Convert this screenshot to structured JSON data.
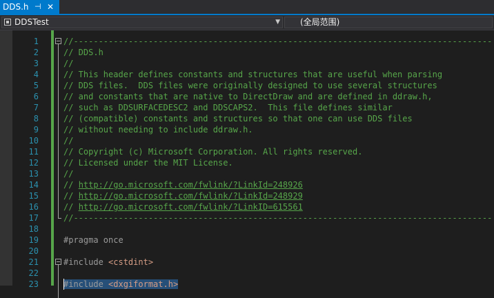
{
  "tab": {
    "filename": "DDS.h",
    "pin_glyph": "⊣",
    "close_glyph": "✕"
  },
  "navigation": {
    "project": "DDSTest",
    "scope": "(全局范围)"
  },
  "editor": {
    "lines": [
      {
        "num": "1",
        "text": "//------------------------------------------------------------------------------------",
        "kind": "comment"
      },
      {
        "num": "2",
        "text": "// DDS.h",
        "kind": "comment"
      },
      {
        "num": "3",
        "text": "//",
        "kind": "comment"
      },
      {
        "num": "4",
        "text": "// This header defines constants and structures that are useful when parsing",
        "kind": "comment"
      },
      {
        "num": "5",
        "text": "// DDS files.  DDS files were originally designed to use several structures",
        "kind": "comment"
      },
      {
        "num": "6",
        "text": "// and constants that are native to DirectDraw and are defined in ddraw.h,",
        "kind": "comment"
      },
      {
        "num": "7",
        "text": "// such as DDSURFACEDESC2 and DDSCAPS2.  This file defines similar",
        "kind": "comment"
      },
      {
        "num": "8",
        "text": "// (compatible) constants and structures so that one can use DDS files",
        "kind": "comment"
      },
      {
        "num": "9",
        "text": "// without needing to include ddraw.h.",
        "kind": "comment"
      },
      {
        "num": "10",
        "text": "//",
        "kind": "comment"
      },
      {
        "num": "11",
        "text": "// Copyright (c) Microsoft Corporation. All rights reserved.",
        "kind": "comment"
      },
      {
        "num": "12",
        "text": "// Licensed under the MIT License.",
        "kind": "comment"
      },
      {
        "num": "13",
        "text": "//",
        "kind": "comment"
      },
      {
        "num": "14",
        "prefix": "// ",
        "link": "http://go.microsoft.com/fwlink/?LinkId=248926",
        "kind": "link"
      },
      {
        "num": "15",
        "prefix": "// ",
        "link": "http://go.microsoft.com/fwlink/?LinkId=248929",
        "kind": "link"
      },
      {
        "num": "16",
        "prefix": "// ",
        "link": "http://go.microsoft.com/fwlink/?LinkID=615561",
        "kind": "link"
      },
      {
        "num": "17",
        "text": "//------------------------------------------------------------------------------------",
        "kind": "comment"
      },
      {
        "num": "18",
        "text": "",
        "kind": "plain"
      },
      {
        "num": "19",
        "text": "#pragma once",
        "kind": "pp"
      },
      {
        "num": "20",
        "text": "",
        "kind": "plain"
      },
      {
        "num": "21",
        "directive": "#include ",
        "header": "<cstdint>",
        "kind": "include"
      },
      {
        "num": "22",
        "text": "",
        "kind": "plain"
      },
      {
        "num": "23",
        "directive": "#include ",
        "header": "<dxgiformat.h>",
        "kind": "include",
        "selected": true
      }
    ]
  },
  "colors": {
    "accent": "#007acc",
    "comment": "#57a64a",
    "preprocessor": "#9b9b9b",
    "string": "#d69d85",
    "line_number": "#2b91af",
    "selection": "#264f78"
  }
}
